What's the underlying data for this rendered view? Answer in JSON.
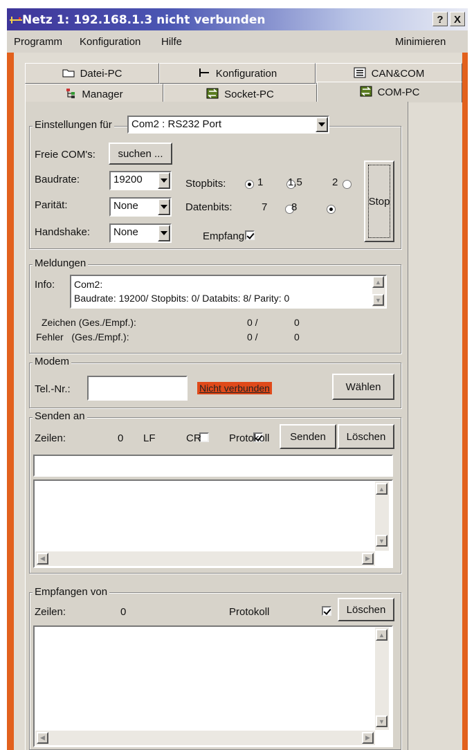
{
  "window": {
    "title": "Netz 1: 192.168.1.3  nicht verbunden",
    "help_btn": "?",
    "close_btn": "X"
  },
  "menu": {
    "items": [
      "Programm",
      "Konfiguration",
      "Hilfe"
    ],
    "minimize": "Minimieren"
  },
  "tabs": {
    "row1": [
      "Datei-PC",
      "Konfiguration",
      "CAN&COM"
    ],
    "row2": [
      "Manager",
      "Socket-PC",
      "COM-PC"
    ],
    "selected": "COM-PC"
  },
  "settings": {
    "legend": "Einstellungen für",
    "port": "Com2 : RS232 Port",
    "free_com_label": "Freie COM's:",
    "search_btn": "suchen ...",
    "baud_label": "Baudrate:",
    "baud_value": "19200",
    "parity_label": "Parität:",
    "parity_value": "None",
    "handshake_label": "Handshake:",
    "handshake_value": "None",
    "stopbits_label": "Stopbits:",
    "stopbits_options": [
      "1",
      "1,5",
      "2"
    ],
    "stopbits_selected": "1",
    "databits_label": "Datenbits:",
    "databits_options": [
      "7",
      "8"
    ],
    "databits_selected": "8",
    "receive_label": "Empfang",
    "receive_checked": true,
    "stop_btn": "Stop"
  },
  "messages": {
    "legend": "Meldungen",
    "info_label": "Info:",
    "info_line1": "Com2:",
    "info_line2": "Baudrate: 19200/ Stopbits: 0/ Databits: 8/ Parity: 0",
    "chars_label": "Zeichen (Ges./Empf.):",
    "chars_total": "0 /",
    "chars_recv": "0",
    "errors_label": "Fehler   (Ges./Empf.):",
    "errors_total": "0 /",
    "errors_recv": "0"
  },
  "modem": {
    "legend": "Modem",
    "tel_label": "Tel.-Nr.:",
    "tel_value": "",
    "status": "Nicht verbunden",
    "status_color": "#e04a1a",
    "dial_btn": "Wählen"
  },
  "send": {
    "legend": "Senden an",
    "lines_label": "Zeilen:",
    "lines_value": "0",
    "lf_label": "LF",
    "lf_checked": false,
    "cr_label": "CR",
    "cr_checked": true,
    "protocol_label": "Protokoll",
    "protocol_checked": true,
    "send_btn": "Senden",
    "clear_btn": "Löschen",
    "input_value": ""
  },
  "receive": {
    "legend": "Empfangen von",
    "lines_label": "Zeilen:",
    "lines_value": "0",
    "protocol_label": "Protokoll",
    "protocol_checked": true,
    "clear_btn": "Löschen"
  },
  "colors": {
    "titlebar_start": "#3e3599",
    "frame": "#e2611d",
    "face": "#d7d3ca"
  }
}
